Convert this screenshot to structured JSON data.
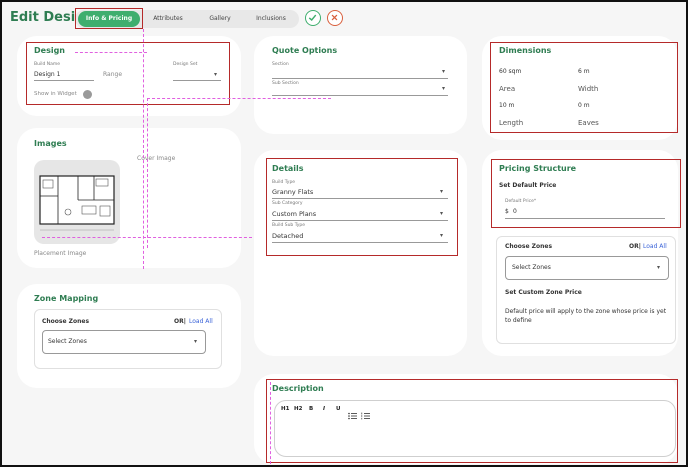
{
  "header": {
    "title": "Edit Design",
    "tabs": [
      {
        "label": "Info & Pricing"
      },
      {
        "label": "Attributes"
      },
      {
        "label": "Gallery"
      },
      {
        "label": "Inclusions"
      }
    ],
    "save_icon": "check-icon",
    "cancel_icon": "close-icon"
  },
  "design": {
    "title": "Design",
    "build_name_label": "Build Name",
    "build_name_value": "Design 1",
    "range_placeholder": "Range",
    "design_set_label": "Design Set",
    "show_in_widget_label": "Show in Widget"
  },
  "quote": {
    "title": "Quote Options",
    "section_label": "Section",
    "sub_section_label": "Sub Section"
  },
  "dimensions": {
    "title": "Dimensions",
    "items": [
      {
        "value": "60 sqm",
        "label": "Area"
      },
      {
        "value": "6 m",
        "label": "Width"
      },
      {
        "value": "10 m",
        "label": "Length"
      },
      {
        "value": "0 m",
        "label": "Eaves"
      }
    ]
  },
  "images": {
    "title": "Images",
    "cover_label": "Cover Image",
    "placement_label": "Placement Image"
  },
  "details": {
    "title": "Details",
    "build_type_label": "Build Type",
    "build_type_value": "Granny Flats",
    "sub_category_label": "Sub Category",
    "sub_category_value": "Custom Plans",
    "build_sub_type_label": "Build Sub Type",
    "build_sub_type_value": "Detached"
  },
  "pricing": {
    "title": "Pricing Structure",
    "set_default_label": "Set Default Price",
    "default_price_label": "Default Price*",
    "currency": "$",
    "default_price_value": "0",
    "choose_zones_label": "Choose Zones",
    "or_label": "OR|",
    "load_all_label": "Load All",
    "select_zones_placeholder": "Select Zones",
    "custom_zone_label": "Set Custom Zone Price",
    "note": "Default price will apply to the zone whose price is yet to define"
  },
  "zone_mapping": {
    "title": "Zone Mapping",
    "choose_zones_label": "Choose Zones",
    "or_label": "OR|",
    "load_all_label": "Load All",
    "select_zones_placeholder": "Select Zones"
  },
  "description": {
    "title": "Description",
    "toolbar": [
      "H1",
      "H2",
      "B",
      "I",
      "U"
    ]
  },
  "colors": {
    "accent_green": "#2f7d52",
    "active_tab": "#3fae6e",
    "highlight_red": "#b52a2a",
    "link_blue": "#3a63d8"
  }
}
